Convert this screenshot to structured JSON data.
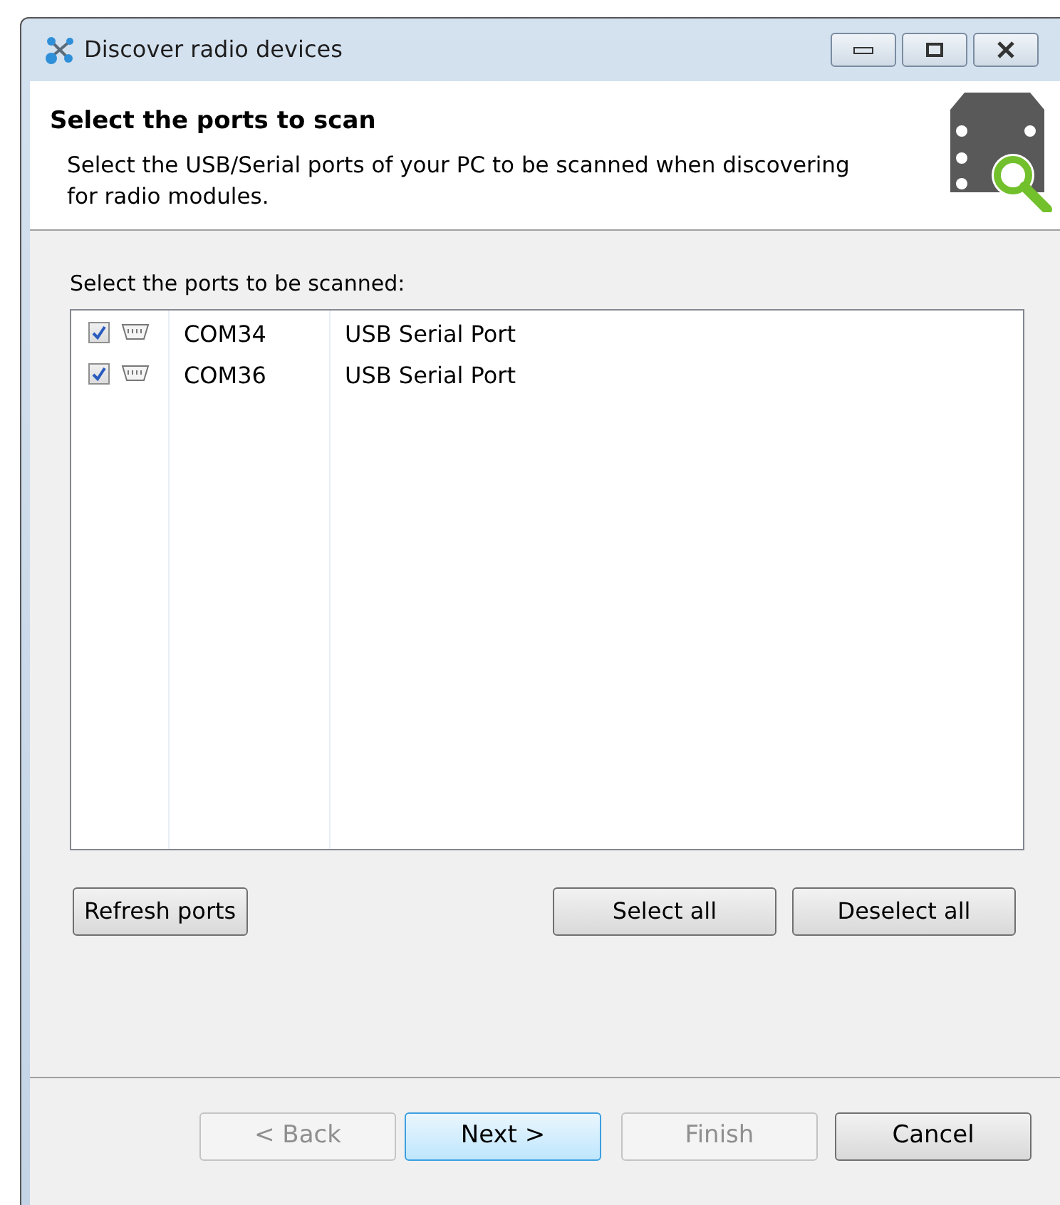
{
  "window": {
    "title": "Discover radio devices"
  },
  "header": {
    "title": "Select the ports to scan",
    "description": "Select the USB/Serial ports of your PC to be scanned when discovering for radio modules."
  },
  "ports_label": "Select the ports to be scanned:",
  "ports": [
    {
      "port": "COM34",
      "description": "USB Serial Port",
      "checked": true
    },
    {
      "port": "COM36",
      "description": "USB Serial Port",
      "checked": true
    }
  ],
  "list_buttons": [
    {
      "label": "Refresh ports"
    },
    {
      "label": "Select all"
    },
    {
      "label": "Deselect all"
    }
  ],
  "wizard_buttons": [
    {
      "label": "< Back",
      "disabled": true,
      "default": false
    },
    {
      "label": "Next >",
      "disabled": false,
      "default": true
    },
    {
      "label": "Finish",
      "disabled": true,
      "default": false
    },
    {
      "label": "Cancel",
      "disabled": false,
      "default": false
    }
  ]
}
